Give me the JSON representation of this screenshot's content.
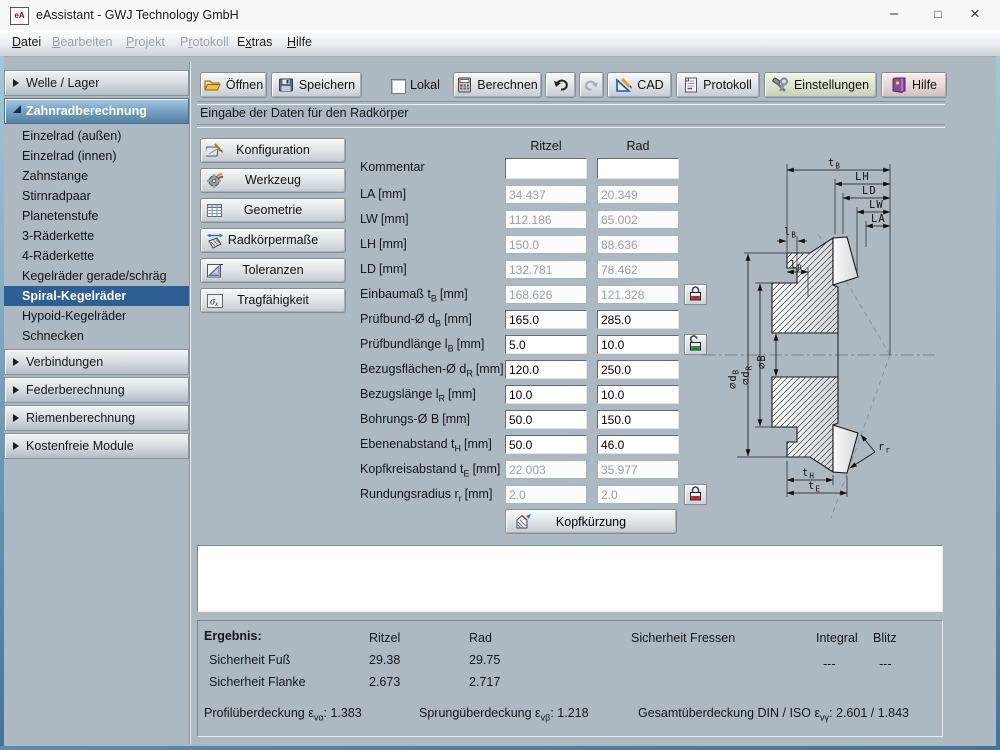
{
  "window": {
    "icon_text": "eA",
    "title": "eAssistant - GWJ Technology GmbH",
    "controls": {
      "minimize": "–",
      "maximize": "□",
      "close": "×"
    }
  },
  "menu": {
    "items": [
      {
        "pre": "",
        "key": "D",
        "rest": "atei"
      },
      {
        "pre": "",
        "key": "B",
        "rest": "earbeiten"
      },
      {
        "pre": "",
        "key": "P",
        "rest": "rojekt"
      },
      {
        "pre": "P",
        "key": "r",
        "rest": "otokoll"
      },
      {
        "pre": "E",
        "key": "x",
        "rest": "tras"
      },
      {
        "pre": "",
        "key": "H",
        "rest": "ilfe"
      }
    ]
  },
  "sidebar": {
    "sections": [
      {
        "label": "Welle / Lager"
      },
      {
        "label": "Zahnradberechnung"
      },
      {
        "label": "Verbindungen"
      },
      {
        "label": "Federberechnung"
      },
      {
        "label": "Riemenberechnung"
      },
      {
        "label": "Kostenfreie Module"
      }
    ],
    "items": [
      "Einzelrad (außen)",
      "Einzelrad (innen)",
      "Zahnstange",
      "Stirnradpaar",
      "Planetenstufe",
      "3-Räderkette",
      "4-Räderkette",
      "Kegelräder gerade/schräg",
      "Spiral-Kegelräder",
      "Hypoid-Kegelräder",
      "Schnecken"
    ],
    "selected": "Spiral-Kegelräder"
  },
  "toolbar": {
    "open": "Öffnen",
    "save": "Speichern",
    "local": "Lokal",
    "calc": "Berechnen",
    "cad": "CAD",
    "protocol": "Protokoll",
    "settings": "Einstellungen",
    "help": "Hilfe"
  },
  "section_header": "Eingabe der Daten für den Radkörper",
  "nav_buttons": [
    "Konfiguration",
    "Werkzeug",
    "Geometrie",
    "Radkörpermaße",
    "Toleranzen",
    "Tragfähigkeit"
  ],
  "icons": {
    "sigma": "σ",
    "sigma_sub": "x"
  },
  "form": {
    "col_ritzel": "Ritzel",
    "col_rad": "Rad",
    "rows": [
      {
        "label": "Kommentar",
        "sub": "",
        "unit": "",
        "ritzel": "",
        "rad": ""
      },
      {
        "label": "LA",
        "sub": "",
        "unit": "[mm]",
        "ritzel": "34.437",
        "rad": "20.349"
      },
      {
        "label": "LW",
        "sub": "",
        "unit": "[mm]",
        "ritzel": "112.186",
        "rad": "65.002"
      },
      {
        "label": "LH",
        "sub": "",
        "unit": "[mm]",
        "ritzel": "150.0",
        "rad": "88.636"
      },
      {
        "label": "LD",
        "sub": "",
        "unit": "[mm]",
        "ritzel": "132.781",
        "rad": "78.462"
      },
      {
        "label": "Einbaumaß t",
        "sub": "B",
        "unit": "[mm]",
        "ritzel": "168.626",
        "rad": "121.328",
        "lock": "closed"
      },
      {
        "label": "Prüfbund-Ø d",
        "sub": "B",
        "unit": "[mm]",
        "ritzel": "165.0",
        "rad": "285.0"
      },
      {
        "label": "Prüfbundlänge l",
        "sub": "B",
        "unit": "[mm]",
        "ritzel": "5.0",
        "rad": "10.0",
        "lock": "open"
      },
      {
        "label": "Bezugsflächen-Ø d",
        "sub": "R",
        "unit": "[mm]",
        "ritzel": "120.0",
        "rad": "250.0"
      },
      {
        "label": "Bezugslänge l",
        "sub": "R",
        "unit": "[mm]",
        "ritzel": "10.0",
        "rad": "10.0"
      },
      {
        "label": "Bohrungs-Ø B",
        "sub": "",
        "unit": "[mm]",
        "ritzel": "50.0",
        "rad": "150.0"
      },
      {
        "label": "Ebenenabstand t",
        "sub": "H",
        "unit": "[mm]",
        "ritzel": "50.0",
        "rad": "46.0"
      },
      {
        "label": "Kopfkreisabstand t",
        "sub": "E",
        "unit": "[mm]",
        "ritzel": "22.003",
        "rad": "35.977"
      },
      {
        "label": "Rundungsradius r",
        "sub": "r",
        "unit": "[mm]",
        "ritzel": "2.0",
        "rad": "2.0",
        "lock": "closed"
      }
    ],
    "kopfkuerzung": "Kopfkürzung"
  },
  "drawing": {
    "t_b": {
      "m": "t",
      "s": "B"
    },
    "lh": "LH",
    "ld": "LD",
    "lw": "LW",
    "la": "LA",
    "l_b": {
      "m": "l",
      "s": "B"
    },
    "l_r": {
      "m": "l",
      "s": "R"
    },
    "d_b": {
      "m": "∅d",
      "s": "B"
    },
    "d_r": {
      "m": "∅d",
      "s": "R"
    },
    "b": "∅B",
    "t_h": {
      "m": "t",
      "s": "H"
    },
    "t_e": {
      "m": "t",
      "s": "E"
    },
    "r_r": {
      "m": "r",
      "s": "r"
    }
  },
  "results": {
    "title": "Ergebnis:",
    "col_ritzel": "Ritzel",
    "col_rad": "Rad",
    "col_fressen": "Sicherheit Fressen",
    "col_integral": "Integral",
    "col_blitz": "Blitz",
    "rows": [
      {
        "label": "Sicherheit Fuß",
        "ritzel": "29.38",
        "rad": "29.75"
      },
      {
        "label": "Sicherheit Flanke",
        "ritzel": "2.673",
        "rad": "2.717"
      }
    ],
    "integral_value": "---",
    "blitz_value": "---",
    "profil": {
      "label": "Profilüberdeckung ε",
      "sub": "vα",
      "value": ":  1.383"
    },
    "sprung": {
      "label": "Sprungüberdeckung ε",
      "sub": "vβ",
      "value": ":  1.218"
    },
    "gesamt": {
      "label": "Gesamtüberdeckung DIN / ISO ε",
      "sub": "vγ",
      "value": ":   2.601   /   1.843"
    }
  },
  "colors": {
    "background": "#aeb8c1",
    "selection_blue": "#2d5e94",
    "header_blue": "#7ba4c8",
    "frame_blue": "#41749c",
    "lock_closed": "#cc2222",
    "lock_open": "#1f8f3a"
  }
}
